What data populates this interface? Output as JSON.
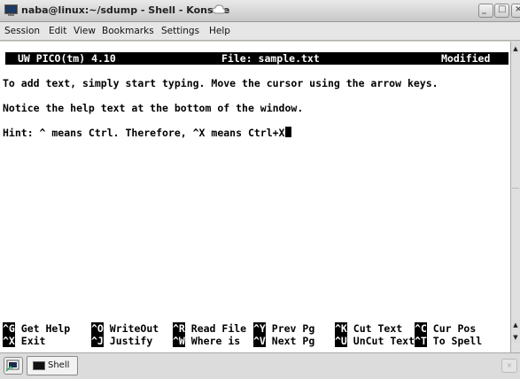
{
  "window": {
    "title": "naba@linux:~/sdump - Shell - Konsole",
    "min_glyph": "_",
    "max_glyph": "□",
    "close_glyph": "×"
  },
  "menubar": {
    "items": [
      "Session",
      "Edit",
      "View",
      "Bookmarks",
      "Settings",
      "Help"
    ]
  },
  "editor": {
    "name": "UW PICO(tm) 4.10",
    "file": "File: sample.txt",
    "status": "Modified",
    "lines": [
      "To add text, simply start typing. Move the cursor using the arrow keys.",
      "Notice the help text at the bottom of the window.",
      "Hint: ^ means Ctrl. Therefore, ^X means Ctrl+X"
    ]
  },
  "help": {
    "row1": [
      {
        "key": "^G",
        "label": " Get Help"
      },
      {
        "key": "^O",
        "label": " WriteOut"
      },
      {
        "key": "^R",
        "label": " Read File"
      },
      {
        "key": "^Y",
        "label": " Prev Pg"
      },
      {
        "key": "^K",
        "label": " Cut Text"
      },
      {
        "key": "^C",
        "label": " Cur Pos"
      }
    ],
    "row2": [
      {
        "key": "^X",
        "label": " Exit"
      },
      {
        "key": "^J",
        "label": " Justify"
      },
      {
        "key": "^W",
        "label": " Where is"
      },
      {
        "key": "^V",
        "label": " Next Pg"
      },
      {
        "key": "^U",
        "label": " UnCut Text"
      },
      {
        "key": "^T",
        "label": " To Spell"
      }
    ]
  },
  "scrollbar": {
    "up_glyph": "▲",
    "down_glyph": "▼"
  },
  "tabbar": {
    "tab_label": "Shell"
  },
  "icons": {
    "app": "terminal-icon",
    "new_tab": "new-tab-icon",
    "tab": "shell-tab-icon",
    "close_tab": "close-tab-icon"
  }
}
